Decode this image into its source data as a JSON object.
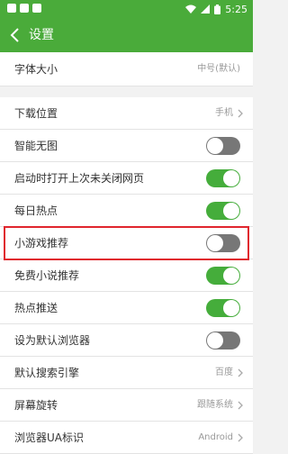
{
  "status_bar": {
    "time": "5:25"
  },
  "header": {
    "title": "设置"
  },
  "rows": {
    "font_size": {
      "label": "字体大小",
      "value": "中号(默认)"
    },
    "download_location": {
      "label": "下载位置",
      "value": "手机"
    },
    "smart_no_image": {
      "label": "智能无图",
      "on": false
    },
    "reopen_pages": {
      "label": "启动时打开上次未关闭网页",
      "on": true
    },
    "daily_hot": {
      "label": "每日热点",
      "on": true
    },
    "mini_games": {
      "label": "小游戏推荐",
      "on": false
    },
    "free_novels": {
      "label": "免费小说推荐",
      "on": true
    },
    "hot_push": {
      "label": "热点推送",
      "on": true
    },
    "default_browser": {
      "label": "设为默认浏览器",
      "on": false
    },
    "search_engine": {
      "label": "默认搜索引擎",
      "value": "百度"
    },
    "screen_rotation": {
      "label": "屏幕旋转",
      "value": "跟随系统"
    },
    "ua": {
      "label": "浏览器UA标识",
      "value": "Android"
    }
  },
  "highlight_color": "#e0262e",
  "accent_color": "#4aab3a"
}
